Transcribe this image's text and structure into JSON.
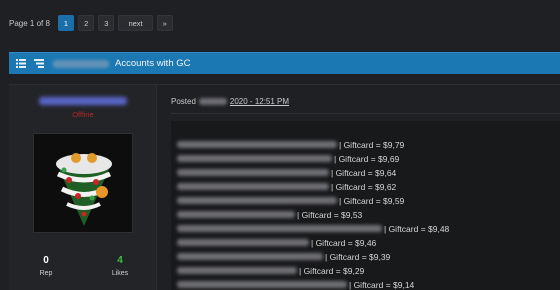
{
  "pagination": {
    "label": "Page 1 of 8",
    "pages": [
      "1",
      "2",
      "3"
    ],
    "active": "1",
    "next_label": "next",
    "last_label": "»"
  },
  "thread": {
    "title": "Accounts with GC"
  },
  "post": {
    "status": "Offline",
    "posted_label": "Posted",
    "date": "2020 - 12:51 PM",
    "rep_value": "0",
    "rep_label": "Rep",
    "likes_value": "4",
    "likes_label": "Likes",
    "lines": [
      "| Giftcard = $9,79",
      "| Giftcard = $9,69",
      "| Giftcard = $9,64",
      "| Giftcard = $9,62",
      "| Giftcard = $9,59",
      "| Giftcard = $9,53",
      "| Giftcard = $9,48",
      "| Giftcard = $9,46",
      "| Giftcard = $9,39",
      "| Giftcard = $9,29",
      "| Giftcard = $9,14"
    ]
  },
  "colors": {
    "accent": "#1b78b3",
    "offline": "#b32828",
    "likes": "#3fbf3f"
  }
}
